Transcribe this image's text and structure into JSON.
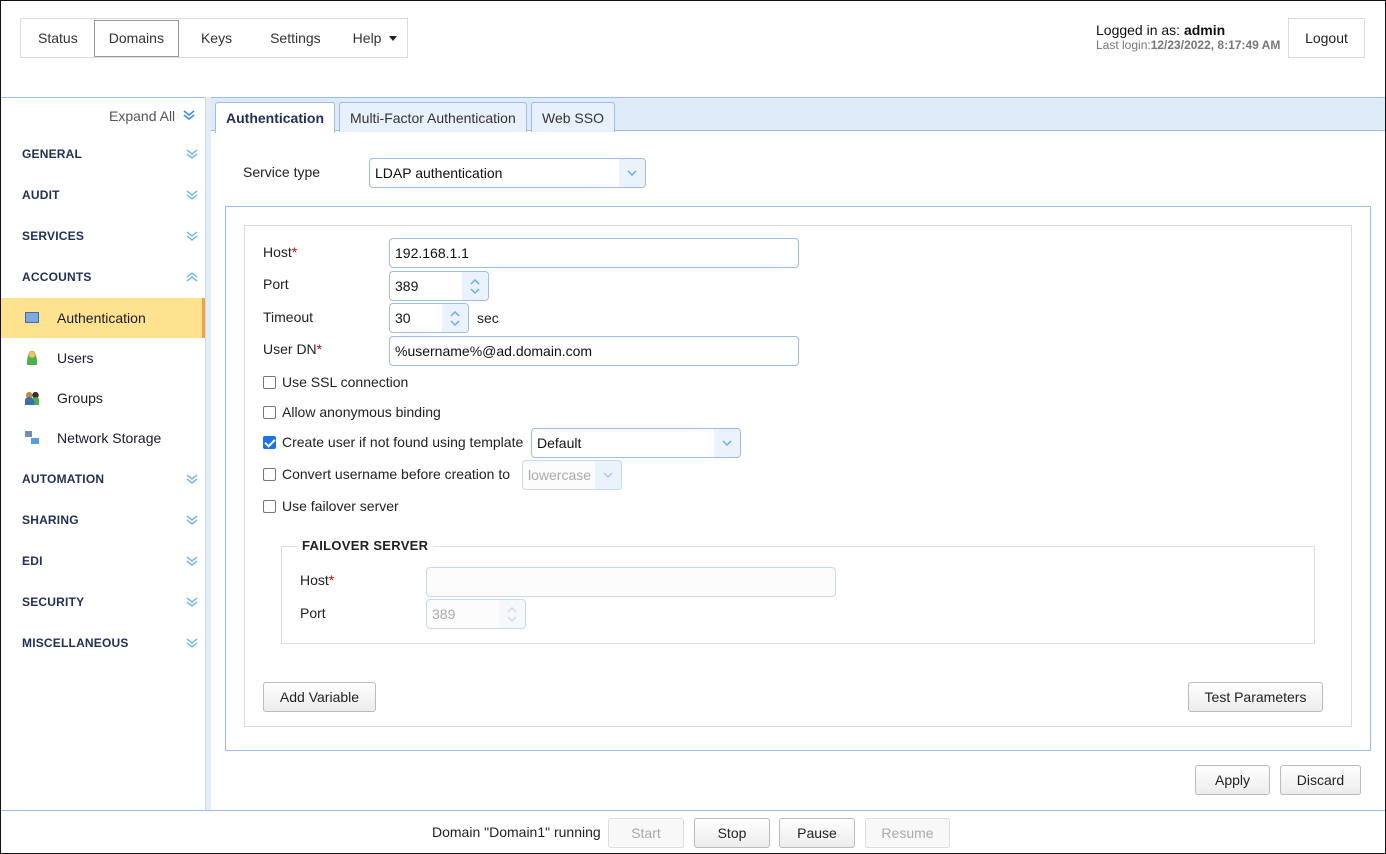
{
  "nav": {
    "items": [
      "Status",
      "Domains",
      "Keys",
      "Settings",
      "Help"
    ],
    "active": "Domains"
  },
  "user": {
    "logged_prefix": "Logged in as: ",
    "username": "admin",
    "last_prefix": "Last login:",
    "last_login": "12/23/2022, 8:17:49 AM",
    "logout": "Logout"
  },
  "sidebar": {
    "expand_all": "Expand All",
    "sections": [
      "GENERAL",
      "AUDIT",
      "SERVICES",
      "ACCOUNTS",
      "AUTOMATION",
      "SHARING",
      "EDI",
      "SECURITY",
      "MISCELLANEOUS"
    ],
    "accounts_items": [
      {
        "label": "Authentication",
        "icon": "id-card-icon",
        "selected": true
      },
      {
        "label": "Users",
        "icon": "user-icon"
      },
      {
        "label": "Groups",
        "icon": "group-icon"
      },
      {
        "label": "Network Storage",
        "icon": "network-icon"
      }
    ]
  },
  "tabs": [
    "Authentication",
    "Multi-Factor Authentication",
    "Web SSO"
  ],
  "form": {
    "service_type_label": "Service type",
    "service_type": "LDAP authentication",
    "host_label": "Host",
    "host": "192.168.1.1",
    "port_label": "Port",
    "port": "389",
    "timeout_label": "Timeout",
    "timeout": "30",
    "timeout_unit": "sec",
    "userdn_label": "User DN",
    "userdn": "%username%@ad.domain.com",
    "required_mark": "*",
    "checks": [
      {
        "label": "Use SSL connection",
        "checked": false
      },
      {
        "label": "Allow anonymous binding",
        "checked": false
      },
      {
        "label": "Create user if not found using template",
        "checked": true
      },
      {
        "label": "Convert username before creation to",
        "checked": false
      },
      {
        "label": "Use failover server",
        "checked": false
      }
    ],
    "template": "Default",
    "convert_case": "lowercase",
    "failover": {
      "legend": "FAILOVER SERVER",
      "host_label": "Host",
      "host": "",
      "port_label": "Port",
      "port": "389"
    },
    "add_variable": "Add Variable",
    "test_parameters": "Test Parameters",
    "apply": "Apply",
    "discard": "Discard"
  },
  "footer": {
    "status": "Domain \"Domain1\" running",
    "start": "Start",
    "stop": "Stop",
    "pause": "Pause",
    "resume": "Resume"
  },
  "colors": {
    "accent": "#9cbde6",
    "selected": "#fde28f",
    "heading": "#1f2f5a",
    "required": "#dd0000"
  }
}
